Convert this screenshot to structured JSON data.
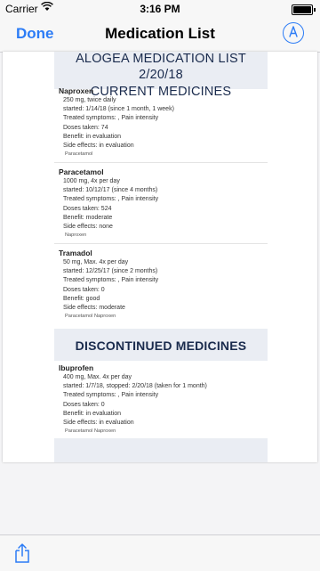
{
  "status_bar": {
    "carrier": "Carrier",
    "time": "3:16 PM"
  },
  "nav": {
    "done_label": "Done",
    "title": "Medication List",
    "markup_icon": "markup-pen-icon"
  },
  "document": {
    "header": {
      "line1": "ALOGEA MEDICATION LIST 2/20/18",
      "line2": "CURRENT MEDICINES"
    },
    "current": [
      {
        "name": "Naproxen",
        "lines": [
          "250 mg, twice daily",
          "started: 1/14/18 (since 1 month, 1 week)",
          "Treated symptoms: , Pain intensity",
          "Doses taken: 74",
          "Benefit: in evaluation",
          "Side effects: in evaluation"
        ],
        "tags": "Paracetamol"
      },
      {
        "name": "Paracetamol",
        "lines": [
          "1000 mg, 4x per day",
          "started: 10/12/17 (since 4 months)",
          "Treated symptoms: , Pain intensity",
          "Doses taken: 524",
          "Benefit: moderate",
          "Side effects: none"
        ],
        "tags": "Naproxen"
      },
      {
        "name": "Tramadol",
        "lines": [
          "50 mg, Max. 4x per day",
          "started: 12/25/17 (since 2 months)",
          "Treated symptoms: , Pain intensity",
          "Doses taken: 0",
          "Benefit: good",
          "Side effects: moderate"
        ],
        "tags": "Paracetamol Naproxen"
      }
    ],
    "discontinued_title": "DISCONTINUED MEDICINES",
    "discontinued": [
      {
        "name": "Ibuprofen",
        "lines": [
          "400 mg, Max. 4x per day",
          "started: 1/7/18, stopped: 2/20/18 (taken for 1 month)",
          "Treated symptoms: , Pain intensity",
          "Doses taken: 0",
          "Benefit: in evaluation",
          "Side effects: in evaluation"
        ],
        "tags": "Paracetamol Naproxen"
      }
    ]
  },
  "toolbar": {
    "share_icon": "share-icon"
  },
  "colors": {
    "accent": "#2c7cf6",
    "band": "#eaedf3",
    "band_text": "#1a2b4d"
  }
}
